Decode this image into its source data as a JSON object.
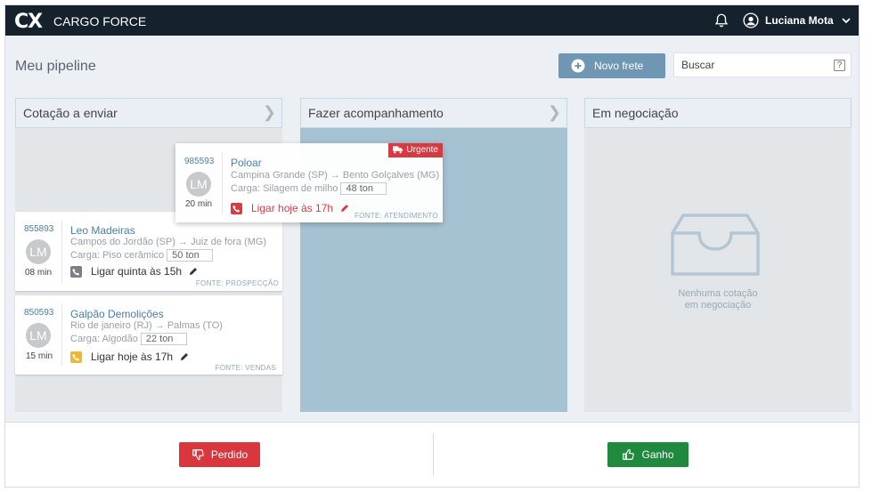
{
  "header": {
    "logo": "CX",
    "brand": "CARGO FORCE",
    "user_name": "Luciana Mota"
  },
  "toolbar": {
    "title": "Meu pipeline",
    "new_button": "Novo frete",
    "search_placeholder": "Buscar",
    "help": "?"
  },
  "columns": [
    {
      "title": "Cotação a enviar",
      "cards": [
        {
          "id": "855893",
          "initials": "LM",
          "time": "08 min",
          "name": "Leo Madeiras",
          "route": "Campos do Jordão (SP) → Juiz de fora (MG)",
          "cargo_label": "Carga: Piso cerâmico",
          "tons": "50 ton",
          "call": "Ligar quinta às 15h",
          "source": "FONTE: PROSPECÇÃO",
          "phone_color": "#7a7f85"
        },
        {
          "id": "850593",
          "initials": "LM",
          "time": "15 min",
          "name": "Galpão Demolições",
          "route": "Rio de janeiro (RJ) → Palmas (TO)",
          "cargo_label": "Carga: Algodão",
          "tons": "22 ton",
          "call": "Ligar hoje às 17h",
          "source": "FONTE: VENDAS",
          "phone_color": "#f2b630"
        }
      ]
    },
    {
      "title": "Fazer acompanhamento",
      "cards": []
    },
    {
      "title": "Em negociação",
      "cards": [],
      "empty_line1": "Nenhuma cotação",
      "empty_line2": "em negociação"
    }
  ],
  "dragged_card": {
    "id": "985593",
    "initials": "LM",
    "time": "20 min",
    "name": "Poloar",
    "route": "Campina Grande (SP) → Bento Golçalves (MG)",
    "cargo_label": "Carga: Silagem de milho",
    "tons": "48 ton",
    "call": "Ligar hoje às 17h",
    "source": "FONTE: ATENDIMENTO",
    "badge": "Urgente",
    "phone_color": "#d9363e"
  },
  "footer": {
    "lost": "Perdido",
    "won": "Ganho"
  },
  "colors": {
    "topbar": "#15212c",
    "primary": "#6f97b3",
    "danger": "#d9363e",
    "success": "#1f8a3e",
    "drop_zone": "#a5c2d2"
  },
  "icons": [
    "bell-icon",
    "user-avatar-icon",
    "chevron-down-icon",
    "plus-circle-icon",
    "help-icon",
    "chevron-right-icon",
    "phone-icon",
    "pencil-icon",
    "truck-icon",
    "inbox-icon",
    "thumbs-down-icon",
    "thumbs-up-icon"
  ]
}
